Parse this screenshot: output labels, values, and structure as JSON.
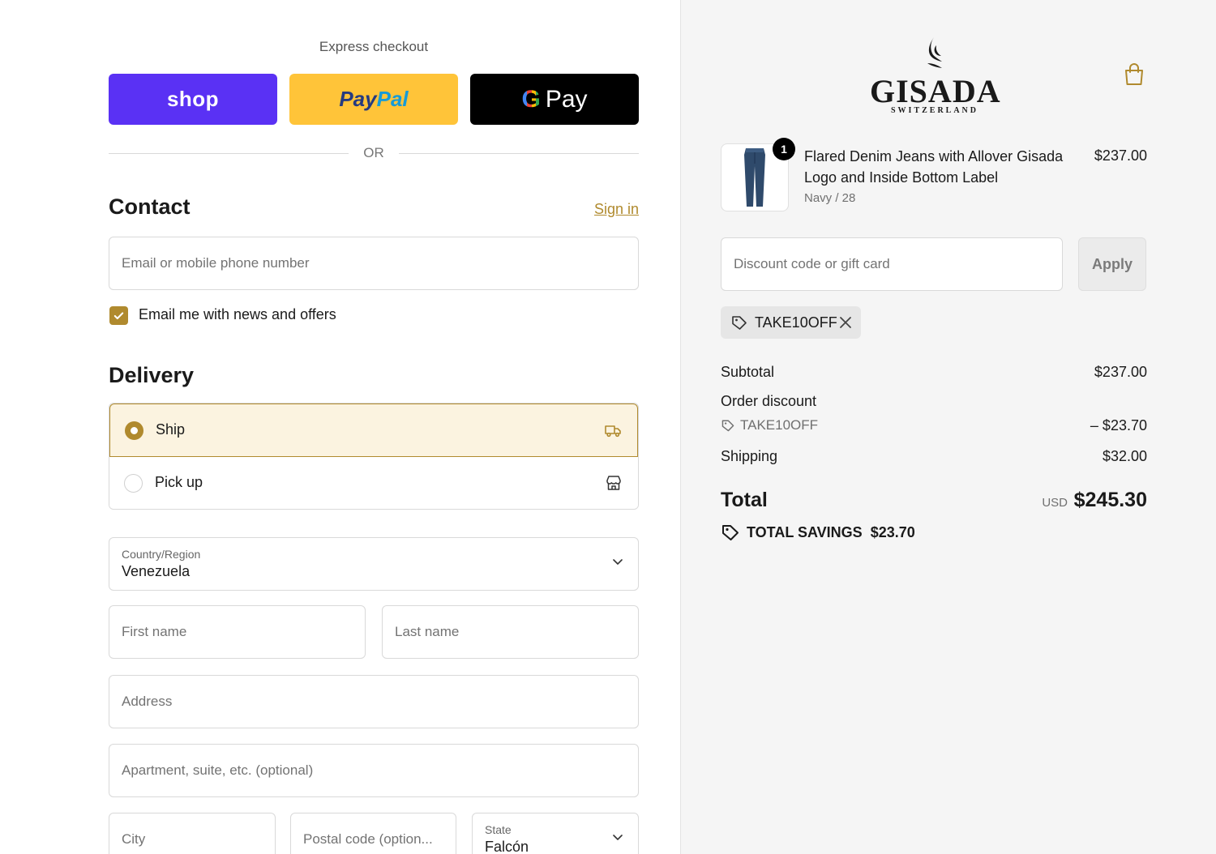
{
  "express": {
    "title": "Express checkout",
    "shop_label": "shop",
    "paypal_label_1": "Pay",
    "paypal_label_2": "Pal",
    "gpay_g": "G",
    "gpay_label": "Pay",
    "or_label": "OR"
  },
  "contact": {
    "heading": "Contact",
    "sign_in": "Sign in",
    "email_placeholder": "Email or mobile phone number",
    "email_value": "",
    "news_opt_in": {
      "checked": true,
      "label": "Email me with news and offers"
    }
  },
  "delivery": {
    "heading": "Delivery",
    "options": [
      {
        "label": "Ship",
        "selected": true,
        "icon": "truck-icon"
      },
      {
        "label": "Pick up",
        "selected": false,
        "icon": "store-icon"
      }
    ],
    "country": {
      "label": "Country/Region",
      "value": "Venezuela"
    },
    "first_name_placeholder": "First name",
    "last_name_placeholder": "Last name",
    "address_placeholder": "Address",
    "apartment_placeholder": "Apartment, suite, etc. (optional)",
    "city_placeholder": "City",
    "postal_placeholder": "Postal code (option...",
    "state": {
      "label": "State",
      "value": "Falcón"
    }
  },
  "brand": {
    "name": "GISADA",
    "sub": "SWITZERLAND"
  },
  "cart": {
    "item": {
      "quantity": "1",
      "name": "Flared Denim Jeans with Allover Gisada Logo and Inside Bottom Label",
      "variant": "Navy / 28",
      "price": "$237.00"
    },
    "discount_placeholder": "Discount code or gift card",
    "apply_label": "Apply",
    "applied_code": "TAKE10OFF"
  },
  "summary": {
    "subtotal_label": "Subtotal",
    "subtotal_value": "$237.00",
    "order_discount_label": "Order discount",
    "discount_code": "TAKE10OFF",
    "discount_value": "– $23.70",
    "shipping_label": "Shipping",
    "shipping_value": "$32.00",
    "total_label": "Total",
    "currency": "USD",
    "total_value": "$245.30",
    "savings_label": "TOTAL SAVINGS",
    "savings_value": "$23.70"
  },
  "colors": {
    "accent": "#b08a2e",
    "shop_purple": "#5a31f4",
    "paypal_yellow": "#ffc439",
    "ship_highlight": "#fbf3e0",
    "right_panel_bg": "#f5f5f5"
  }
}
